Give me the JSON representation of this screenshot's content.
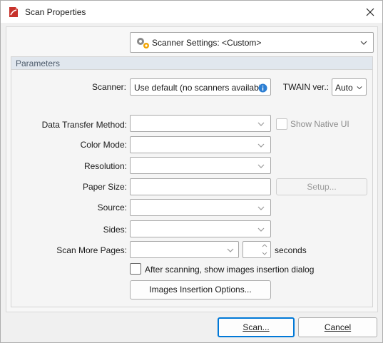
{
  "window": {
    "title": "Scan Properties"
  },
  "settings": {
    "label": "Scanner Settings:  <Custom>"
  },
  "parameters": {
    "title": "Parameters",
    "scanner_label": "Scanner:",
    "scanner_value": "Use default (no scanners available)",
    "twain_label": "TWAIN ver.:",
    "twain_value": "Auto",
    "data_transfer_label": "Data Transfer Method:",
    "show_native_ui_label": "Show Native UI",
    "color_mode_label": "Color Mode:",
    "resolution_label": "Resolution:",
    "paper_size_label": "Paper Size:",
    "setup_label": "Setup...",
    "source_label": "Source:",
    "sides_label": "Sides:",
    "scan_more_label": "Scan More Pages:",
    "seconds_label": "seconds",
    "after_scan_label": "After scanning, show images insertion dialog",
    "images_options_label": "Images Insertion Options..."
  },
  "footer": {
    "scan_label": "Scan...",
    "cancel_label": "Cancel"
  },
  "colors": {
    "accent": "#0078d7",
    "app_icon": "#c7322b",
    "group_header": "#e1e7ee"
  },
  "icons": {
    "app": "foxit-pdf-icon",
    "close": "close-icon",
    "settings": "gears-icon",
    "info": "info-icon"
  }
}
